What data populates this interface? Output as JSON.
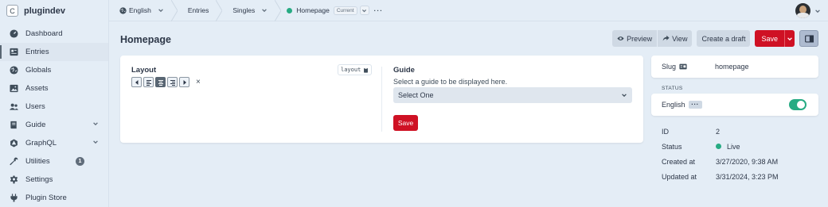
{
  "sidebar": {
    "brand_letter": "C",
    "brand_name": "plugindev",
    "items": [
      {
        "label": "Dashboard",
        "icon": "gauge-icon"
      },
      {
        "label": "Entries",
        "icon": "newspaper-icon",
        "active": true
      },
      {
        "label": "Globals",
        "icon": "globe-icon"
      },
      {
        "label": "Assets",
        "icon": "image-icon"
      },
      {
        "label": "Users",
        "icon": "users-icon"
      },
      {
        "label": "Guide",
        "icon": "book-icon",
        "has_submenu": true
      },
      {
        "label": "GraphQL",
        "icon": "graphql-icon",
        "has_submenu": true
      },
      {
        "label": "Utilities",
        "icon": "wrench-icon",
        "badge": "1"
      },
      {
        "label": "Settings",
        "icon": "gear-icon"
      },
      {
        "label": "Plugin Store",
        "icon": "plug-icon"
      }
    ]
  },
  "topbar": {
    "site": "English",
    "section": "Entries",
    "type": "Singles",
    "entry": "Homepage",
    "current_label": "Current",
    "more": "···"
  },
  "header": {
    "title": "Homepage",
    "preview_label": "Preview",
    "view_label": "View",
    "create_draft_label": "Create a draft",
    "save_label": "Save"
  },
  "layout_field": {
    "label": "Layout",
    "handle": "layout",
    "clear": "×"
  },
  "guide_field": {
    "title": "Guide",
    "description": "Select a guide to be displayed here.",
    "select_value": "Select One",
    "save_label": "Save"
  },
  "meta": {
    "slug_label": "Slug",
    "slug_value": "homepage",
    "status_heading": "STATUS",
    "site_name": "English",
    "site_more": "···",
    "site_enabled": true,
    "rows": [
      {
        "key": "ID",
        "value": "2"
      },
      {
        "key": "Status",
        "value": "Live"
      },
      {
        "key": "Created at",
        "value": "3/27/2020, 9:38 AM"
      },
      {
        "key": "Updated at",
        "value": "3/31/2024, 3:23 PM"
      }
    ]
  },
  "colors": {
    "accent_red": "#cf1124",
    "live_green": "#27ab83",
    "background": "#e4edf6"
  }
}
